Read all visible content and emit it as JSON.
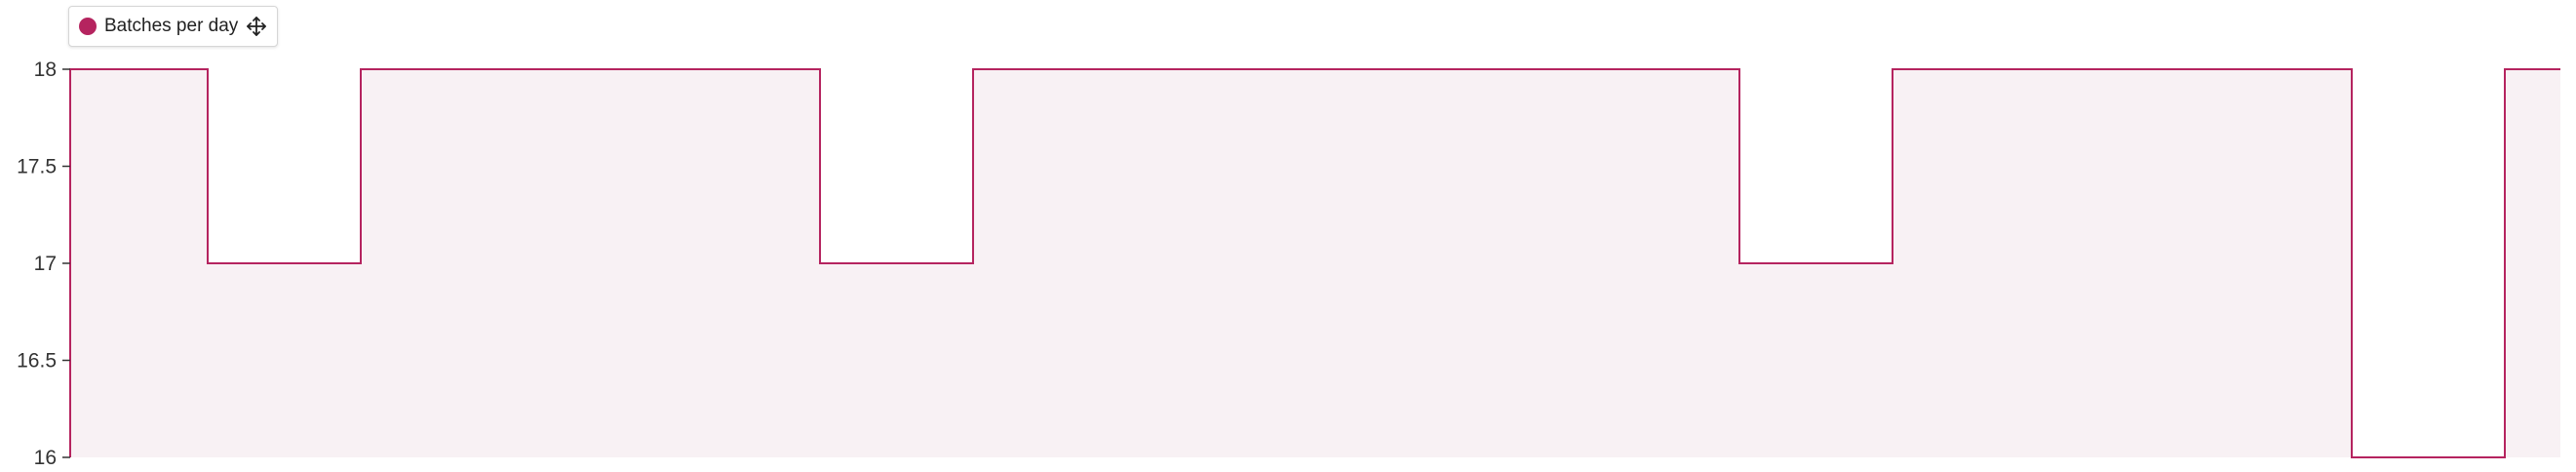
{
  "legend": {
    "series_label": "Batches per day",
    "move_icon": "move-icon"
  },
  "colors": {
    "series": "#b5245f",
    "fill": "#f8f1f4",
    "axis": "#333333"
  },
  "chart_data": {
    "type": "area",
    "step": true,
    "title": "",
    "xlabel": "",
    "ylabel": "",
    "ylim": [
      16,
      18
    ],
    "yticks": [
      "16",
      "16.5",
      "17",
      "17.5",
      "18"
    ],
    "grid": false,
    "legend_position": "top-left",
    "series": [
      {
        "name": "Batches per day",
        "values": [
          18,
          17,
          18,
          18,
          18,
          17,
          18,
          18,
          18,
          18,
          18,
          17,
          18,
          18,
          18,
          16,
          18
        ]
      }
    ]
  }
}
